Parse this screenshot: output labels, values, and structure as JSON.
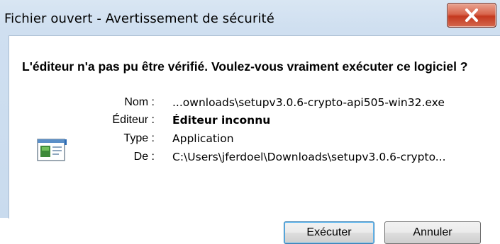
{
  "window": {
    "title": "Fichier ouvert - Avertissement de sécurité"
  },
  "dialog": {
    "heading": "L'éditeur n'a pas pu être vérifié. Voulez-vous vraiment exécuter ce logiciel ?",
    "fields": [
      {
        "label": "Nom :",
        "value": "...ownloads\\setupv3.0.6-crypto-api505-win32.exe",
        "bold": false
      },
      {
        "label": "Éditeur :",
        "value": "Éditeur inconnu",
        "bold": true
      },
      {
        "label": "Type :",
        "value": "Application",
        "bold": false
      },
      {
        "label": "De :",
        "value": "C:\\Users\\jferdoel\\Downloads\\setupv3.0.6-crypto...",
        "bold": false
      }
    ]
  },
  "buttons": {
    "run_label": "Exécuter",
    "cancel_label": "Annuler"
  },
  "icons": {
    "close": "close-icon",
    "file": "application-file-icon"
  },
  "colors": {
    "close_button": "#c4391f",
    "default_button_border": "#3c7fb1"
  }
}
